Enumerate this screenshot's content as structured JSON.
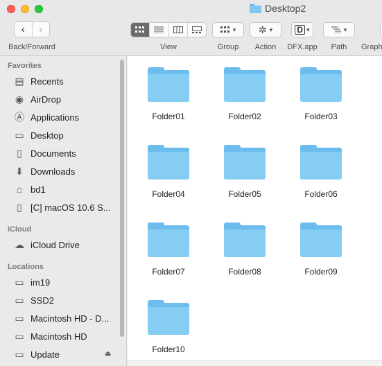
{
  "window": {
    "title": "Desktop2",
    "traffic_lights": [
      "close",
      "minimize",
      "zoom"
    ]
  },
  "toolbar": {
    "nav_label": "Back/Forward",
    "back_glyph": "‹",
    "forward_glyph": "›",
    "view_label": "View",
    "group_label": "Group",
    "action_label": "Action",
    "dfx_label": "DFX.app",
    "dfx_glyph": "D",
    "path_label": "Path",
    "graph_label": "Graph",
    "selected_view": "icon-view"
  },
  "sidebar": {
    "favorites_header": "Favorites",
    "favorites": [
      {
        "label": "Recents",
        "icon": "recents-icon",
        "glyph": "▤"
      },
      {
        "label": "AirDrop",
        "icon": "airdrop-icon",
        "glyph": "◉"
      },
      {
        "label": "Applications",
        "icon": "applications-icon",
        "glyph": "Ⓐ"
      },
      {
        "label": "Desktop",
        "icon": "desktop-icon",
        "glyph": "▭"
      },
      {
        "label": "Documents",
        "icon": "documents-icon",
        "glyph": "▯"
      },
      {
        "label": "Downloads",
        "icon": "downloads-icon",
        "glyph": "⬇"
      },
      {
        "label": "bd1",
        "icon": "home-icon",
        "glyph": "⌂"
      },
      {
        "label": "[C] macOS 10.6 S...",
        "icon": "document-icon",
        "glyph": "▯"
      }
    ],
    "icloud_header": "iCloud",
    "icloud": [
      {
        "label": "iCloud Drive",
        "icon": "cloud-icon",
        "glyph": "☁"
      }
    ],
    "locations_header": "Locations",
    "locations": [
      {
        "label": "im19",
        "icon": "computer-icon",
        "glyph": "▭"
      },
      {
        "label": "SSD2",
        "icon": "drive-icon",
        "glyph": "▭"
      },
      {
        "label": "Macintosh HD - D...",
        "icon": "drive-icon",
        "glyph": "▭"
      },
      {
        "label": "Macintosh HD",
        "icon": "drive-icon",
        "glyph": "▭"
      },
      {
        "label": "Update",
        "icon": "drive-icon",
        "glyph": "▭"
      }
    ],
    "eject_glyph": "⏏"
  },
  "folders": [
    {
      "name": "Folder01"
    },
    {
      "name": "Folder02"
    },
    {
      "name": "Folder03"
    },
    {
      "name": "Folder04"
    },
    {
      "name": "Folder05"
    },
    {
      "name": "Folder06"
    },
    {
      "name": "Folder07"
    },
    {
      "name": "Folder08"
    },
    {
      "name": "Folder09"
    },
    {
      "name": "Folder10"
    }
  ],
  "colors": {
    "folder_front": "#86cdf4",
    "folder_back": "#6cbcee",
    "close": "#fe5f57",
    "minimize": "#febc2e",
    "zoom": "#28c840"
  }
}
